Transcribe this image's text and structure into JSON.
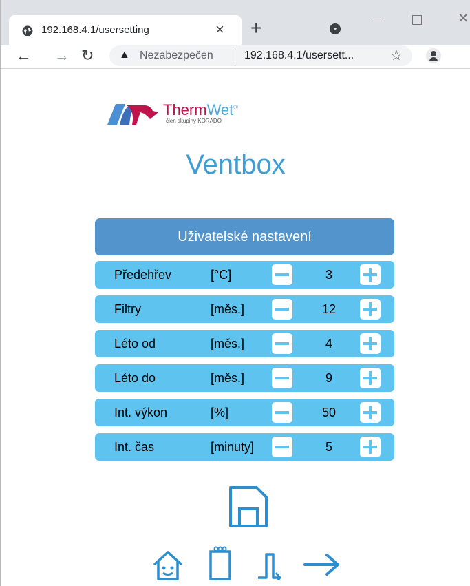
{
  "browser": {
    "tab_title": "192.168.4.1/usersetting",
    "security_label": "Nezabezpečen",
    "url_display": "192.168.4.1/usersett..."
  },
  "logo": {
    "brand_therm": "Therm",
    "brand_wet": "Wet",
    "brand_reg": "®",
    "subtitle": "člen skupiny KORADO"
  },
  "page_title": "Ventbox",
  "panel": {
    "header": "Uživatelské nastavení",
    "rows": [
      {
        "label": "Předehřev",
        "unit": "[°C]",
        "value": "3"
      },
      {
        "label": "Filtry",
        "unit": "[měs.]",
        "value": "12"
      },
      {
        "label": "Léto od",
        "unit": "[měs.]",
        "value": "4"
      },
      {
        "label": "Léto do",
        "unit": "[měs.]",
        "value": "9"
      },
      {
        "label": "Int. výkon",
        "unit": "[%]",
        "value": "50"
      },
      {
        "label": "Int. čas",
        "unit": "[minuty]",
        "value": "5"
      }
    ]
  },
  "icons": {
    "save": "save-icon",
    "home": "home-icon",
    "notepad": "notepad-icon",
    "pulse": "pulse-icon",
    "next": "arrow-right-icon"
  },
  "colors": {
    "accent": "#3e9ed4",
    "header_bg": "#5494cd",
    "row_bg": "#5fc3ef",
    "logo_red": "#c0144c"
  }
}
